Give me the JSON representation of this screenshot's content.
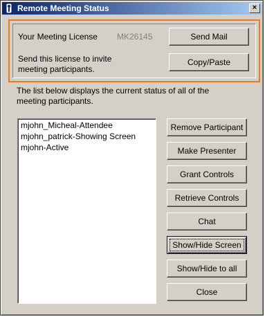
{
  "window": {
    "title": "Remote Meeting Status",
    "close_label": "×"
  },
  "license": {
    "label": "Your Meeting License",
    "value": "MK26145",
    "hint_line1": "Send this license to invite",
    "hint_line2": "meeting participants.",
    "send_mail": "Send Mail",
    "copy_paste": "Copy/Paste"
  },
  "description": {
    "line1": "The list below displays the current status of all of the",
    "line2": "meeting participants."
  },
  "participants": [
    "mjohn_Micheal-Attendee",
    "mjohn_patrick-Showing Screen",
    "mjohn-Active"
  ],
  "buttons": {
    "remove": "Remove Participant",
    "make_presenter": "Make Presenter",
    "grant": "Grant Controls",
    "retrieve": "Retrieve Controls",
    "chat": "Chat",
    "show_hide_screen": "Show/Hide Screen",
    "show_hide_all": "Show/Hide to all",
    "close": "Close"
  },
  "colors": {
    "accent_border": "#f07820",
    "title_bar": "#0a246a",
    "dialog_bg": "#d4d0c8"
  },
  "icons": {
    "title": "app-key-icon",
    "close": "close-icon"
  }
}
